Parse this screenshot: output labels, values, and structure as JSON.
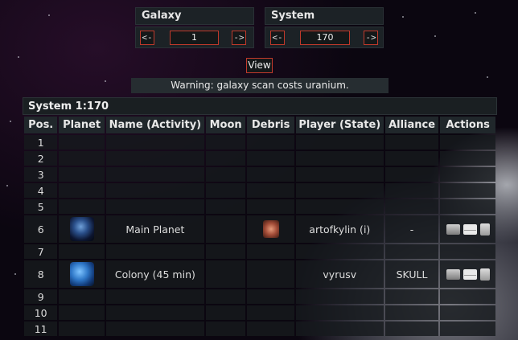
{
  "galaxy_selector": {
    "title": "Galaxy",
    "prev": "<-",
    "value": "1",
    "next": "->"
  },
  "system_selector": {
    "title": "System",
    "prev": "<-",
    "value": "170",
    "next": "->"
  },
  "view_button": "View",
  "warning": "Warning: galaxy scan costs uranium.",
  "system_header": "System 1:170",
  "columns": [
    "Pos.",
    "Planet",
    "Name (Activity)",
    "Moon",
    "Debris",
    "Player (State)",
    "Alliance",
    "Actions"
  ],
  "rows": [
    {
      "pos": "1",
      "name": "",
      "player": "",
      "alliance": ""
    },
    {
      "pos": "2",
      "name": "",
      "player": "",
      "alliance": ""
    },
    {
      "pos": "3",
      "name": "",
      "player": "",
      "alliance": ""
    },
    {
      "pos": "4",
      "name": "",
      "player": "",
      "alliance": ""
    },
    {
      "pos": "5",
      "name": "",
      "player": "",
      "alliance": ""
    },
    {
      "pos": "6",
      "name": "Main Planet",
      "player": "artofkylin (i)",
      "alliance": "-",
      "planet_icon": "planet-main-icon",
      "debris_icon": "debris-field-icon"
    },
    {
      "pos": "7",
      "name": "",
      "player": "",
      "alliance": ""
    },
    {
      "pos": "8",
      "name": "Colony (45 min)",
      "player": "vyrusv",
      "alliance": "SKULL",
      "planet_icon": "planet-colony-icon"
    },
    {
      "pos": "9",
      "name": "",
      "player": "",
      "alliance": ""
    },
    {
      "pos": "10",
      "name": "",
      "player": "",
      "alliance": ""
    },
    {
      "pos": "11",
      "name": "",
      "player": "",
      "alliance": ""
    }
  ],
  "action_icons": [
    "espionage-icon",
    "message-icon",
    "buddy-request-icon"
  ],
  "colors": {
    "accent_border": "#c0392b",
    "panel_bg": "#1c2226",
    "header_bg": "#20272b"
  }
}
